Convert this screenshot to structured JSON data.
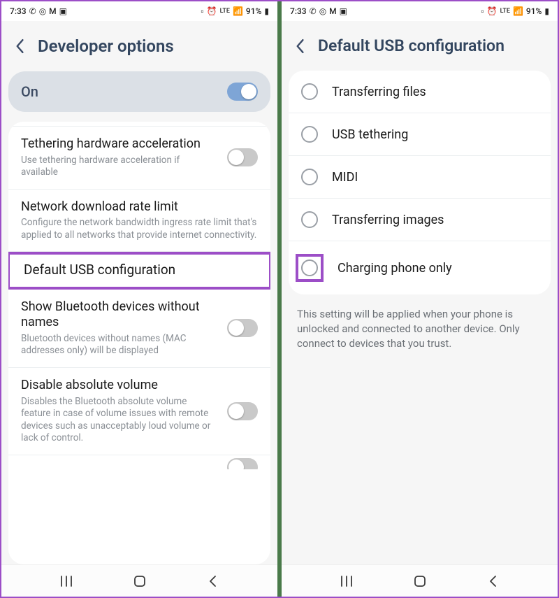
{
  "status": {
    "time": "7:33",
    "battery": "91%"
  },
  "left": {
    "title": "Developer options",
    "on_label": "On",
    "rows": [
      {
        "title": "Tethering hardware acceleration",
        "desc": "Use tethering hardware acceleration if available",
        "toggle": "off"
      },
      {
        "title": "Network download rate limit",
        "desc": "Configure the network bandwidth ingress rate limit that's applied to all networks that provide internet connectivity.",
        "toggle": null
      },
      {
        "title": "Default USB configuration",
        "desc": null,
        "toggle": null,
        "highlight": true
      },
      {
        "title": "Show Bluetooth devices without names",
        "desc": "Bluetooth devices without names (MAC addresses only) will be displayed",
        "toggle": "off"
      },
      {
        "title": "Disable absolute volume",
        "desc": "Disables the Bluetooth absolute volume feature in case of volume issues with remote devices such as unacceptably loud volume or lack of control.",
        "toggle": "off"
      }
    ]
  },
  "right": {
    "title": "Default USB configuration",
    "options": [
      {
        "label": "Transferring files"
      },
      {
        "label": "USB tethering"
      },
      {
        "label": "MIDI"
      },
      {
        "label": "Transferring images"
      },
      {
        "label": "Charging phone only",
        "highlight": true
      }
    ],
    "note": "This setting will be applied when your phone is unlocked and connected to another device. Only connect to devices that you trust."
  }
}
